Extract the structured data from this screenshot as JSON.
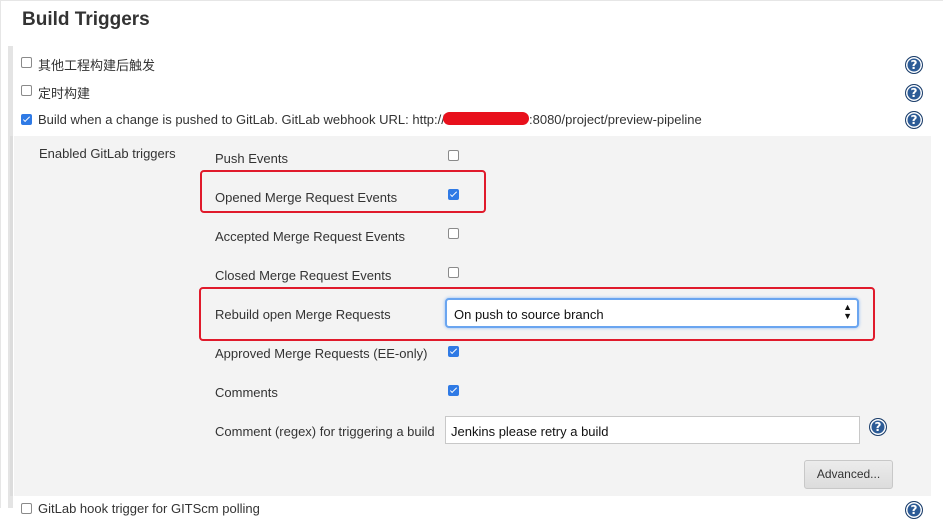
{
  "section": {
    "title": "Build Triggers"
  },
  "triggers": [
    {
      "label": "其他工程构建后触发",
      "checked": false
    },
    {
      "label": "定时构建",
      "checked": false
    },
    {
      "label": "Build when a change is pushed to GitLab. GitLab webhook URL: http://",
      "url_suffix": ":8080/project/preview-pipeline",
      "checked": true
    },
    {
      "label": "GitLab hook trigger for GITScm polling",
      "checked": false
    }
  ],
  "gitlab": {
    "group_label": "Enabled GitLab triggers",
    "options": [
      {
        "label": "Push Events",
        "checked": false
      },
      {
        "label": "Opened Merge Request Events",
        "checked": true
      },
      {
        "label": "Accepted Merge Request Events",
        "checked": false
      },
      {
        "label": "Closed Merge Request Events",
        "checked": false
      },
      {
        "label": "Rebuild open Merge Requests",
        "select_value": "On push to source branch"
      },
      {
        "label": "Approved Merge Requests (EE-only)",
        "checked": true
      },
      {
        "label": "Comments",
        "checked": true
      },
      {
        "label": "Comment (regex) for triggering a build",
        "input_value": "Jenkins please retry a build"
      }
    ],
    "advanced_label": "Advanced..."
  },
  "help_glyph": "?",
  "icons": {
    "help": "help-icon",
    "select_arrows": "updown-arrows-icon"
  },
  "colors": {
    "accent": "#2f7ae5",
    "highlight": "#e01a2b",
    "help": "#2c5b96"
  }
}
